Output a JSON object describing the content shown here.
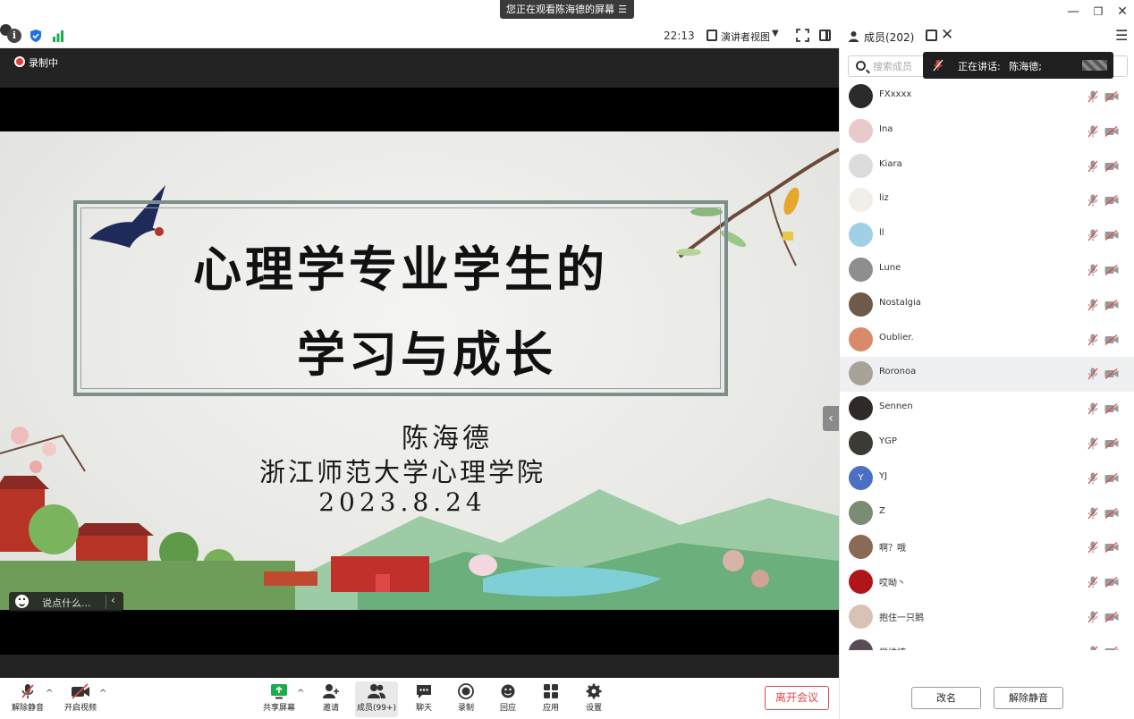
{
  "window": {
    "share_banner": "您正在观看陈海德的屏幕",
    "minimize_glyph": "—",
    "restore_glyph": "❐",
    "close_glyph": "✕"
  },
  "statusbar": {
    "time": "22:13",
    "view_mode": "演讲者视图",
    "caret": "▼"
  },
  "recording": {
    "label": "录制中"
  },
  "slide": {
    "title_line1": "心理学专业学生的",
    "title_line2": "学习与成长",
    "author": "陈海德",
    "institution": "浙江师范大学心理学院",
    "date": "2023.8.24"
  },
  "chat": {
    "placeholder": "说点什么..."
  },
  "panel": {
    "title": "成员(202)",
    "search_placeholder": "搜索成员",
    "speaking_label": "正在讲话:",
    "speaking_name": "陈海德;",
    "hovered_index": 8,
    "members": [
      {
        "name": "FXxxxx",
        "avatar_color": "#2b2b2b",
        "avatar_text": ""
      },
      {
        "name": "Ina",
        "avatar_color": "#e8c9cc",
        "avatar_text": ""
      },
      {
        "name": "Kiara",
        "avatar_color": "#dcdcdc",
        "avatar_text": ""
      },
      {
        "name": "liz",
        "avatar_color": "#f1efe8",
        "avatar_text": ""
      },
      {
        "name": "ll",
        "avatar_color": "#9fd0e6",
        "avatar_text": ""
      },
      {
        "name": "Lune",
        "avatar_color": "#8e8e8e",
        "avatar_text": ""
      },
      {
        "name": "Nostalgia",
        "avatar_color": "#6d5a4a",
        "avatar_text": ""
      },
      {
        "name": "Oublier.",
        "avatar_color": "#d98a6a",
        "avatar_text": ""
      },
      {
        "name": "Roronoa",
        "avatar_color": "#a9a299",
        "avatar_text": ""
      },
      {
        "name": "Sennen",
        "avatar_color": "#2f2a28",
        "avatar_text": ""
      },
      {
        "name": "YGP",
        "avatar_color": "#3c3a35",
        "avatar_text": ""
      },
      {
        "name": "YJ",
        "avatar_color": "#4b6fc4",
        "avatar_text": "Y"
      },
      {
        "name": "Z",
        "avatar_color": "#7a8c74",
        "avatar_text": ""
      },
      {
        "name": "啊？哦",
        "avatar_color": "#8a6a52",
        "avatar_text": ""
      },
      {
        "name": "哎呦丶",
        "avatar_color": "#b0151c",
        "avatar_text": ""
      },
      {
        "name": "抱住一只鹅",
        "avatar_color": "#d8c2b3",
        "avatar_text": ""
      },
      {
        "name": "常维婷",
        "avatar_color": "#5a4c56",
        "avatar_text": ""
      },
      {
        "name": "",
        "avatar_color": "#9bb0c6",
        "avatar_text": ""
      }
    ],
    "rename_label": "改名",
    "unmute_label": "解除静音"
  },
  "toolbar": {
    "mute_label": "解除静音",
    "video_label": "开启视频",
    "share_label": "共享屏幕",
    "invite_label": "邀请",
    "members_label": "成员(99+)",
    "chat_label": "聊天",
    "record_label": "录制",
    "react_label": "回应",
    "apps_label": "应用",
    "settings_label": "设置",
    "leave_label": "离开会议",
    "caret": "^"
  },
  "colors": {
    "accent_green": "#1aad4b",
    "leave_red": "#e04848",
    "record_red": "#e53935"
  }
}
